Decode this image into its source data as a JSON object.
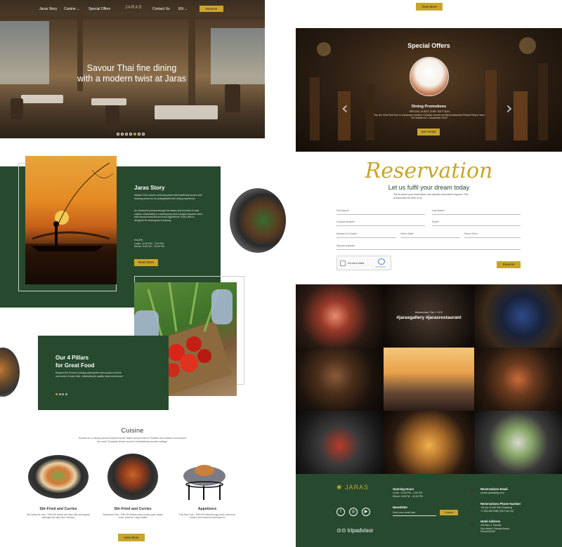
{
  "nav": {
    "items": [
      "Jaras Story",
      "Cuisine",
      "Special Offers",
      "Contact Us",
      "EN"
    ],
    "logo": "JARAS",
    "reserve": "Reserve"
  },
  "hero": {
    "title_line1": "Savour Thai fine dining",
    "title_line2": "with a modern twist at Jaras",
    "slide_count": 7,
    "active_slide": 4
  },
  "story": {
    "title": "Jaras Story",
    "para1": "Modern Thai cuisine, perfectly paired with traditional service and stunning views for an unforgettable fine dining experience.",
    "para2": "An immersive journey through the tastes and textures of local cuisine, showcasing a contemporary and lovingly prepared menu built around seasonal and local ingredients. Every dish is designed for sharing and exploring.",
    "hours_label": "HOURS",
    "lunch": "Lunch: 12:00 PM – 3:00 PM",
    "dinner": "Dinner: 6:00 PM – 10:00 PM",
    "read_more": "Read More"
  },
  "pillars": {
    "title_line1": "Our 4 Pillars",
    "title_line2": "for Great Food",
    "para": "Respect the Product | Always placing the main product at front and center of each dish, celebrating its quality, taste and texture."
  },
  "cuisine": {
    "title": "Cuisine",
    "subtitle": "Embark on a culinary journey inspired by the tastes and textures of Thailand and cuisines from around the world. Exquisite dishes served in breathtaking wooden settings.",
    "dishes": [
      {
        "name": "Stir-Fried and Curries",
        "desc": "Stir-frying the nam • THB 000 Desert sea bass with lemongrass galangal and spicy lime dressing"
      },
      {
        "name": "Stir-Fried and Curries",
        "desc": "Massaman Pae • THB 000 Braised slow-cooked goat, potato onion, peanuts, crispy shallot"
      },
      {
        "name": "Appetizers",
        "desc": "Pruk Nam Sue • THB 000 Steamed egg, fresh crab meat, chicken and seasonal mixed greens"
      }
    ],
    "view_more": "View More"
  },
  "top_view_more": "View More",
  "offers": {
    "title": "Special Offers",
    "promo_title": "Dining Promotions",
    "promo_line1": "SPECIAL GUEST CHEF 30TF SUN",
    "promo_line2": "Top UK Chef Seif Sun to showcase modern Chinese cuisine at InterContinental Phuket Resort from 29 October to 1 November 2019",
    "see_detail": "See Detail"
  },
  "reservation": {
    "script": "Reservation",
    "subtitle": "Let us fulfil your dream today",
    "note": "Tell us about your reservation and special reservation request. This is important for both of us.",
    "fields": {
      "first_name": "First Name*",
      "last_name": "Last Name*",
      "contact": "Contact Number*",
      "email": "Email*",
      "guests": "Number of Guests*",
      "date": "Select Date*",
      "time": "Select Time*",
      "special": "Special requests"
    },
    "captcha": "I'm not a robot",
    "captcha_brand": "reCAPTCHA",
    "reserve": "Reserve"
  },
  "gallery": {
    "caption_small": "Massaman Pae • XXX",
    "caption_tag": "#jarasgallery #jarasrestaurant"
  },
  "footer": {
    "logo": "JARAS",
    "opening_title": "Opening Hours",
    "lunch": "Lunch: 12:00 PM – 3:00 PM",
    "dinner": "Dinner: 6:00 PM – 10:00 PM",
    "newsletter_title": "Newsletter",
    "newsletter_placeholder": "Enter your email here",
    "submit": "Submit",
    "tripadvisor": "tripadvisor",
    "email_title": "Reservations Email",
    "email": "phuket.jaras@ihg.com",
    "phone_title": "Reservations Phone Number",
    "phone1": "+66 (0) 76 629 999 (Thailand)",
    "phone2": "+1 800 408 5385 (Toll Free US)",
    "address_title": "Hotel Address",
    "address1": "333 Moo 3, Kamala",
    "address2": "Sub-district, Kamala Beach,",
    "address3": "Phuket 83150"
  },
  "colors": {
    "green": "#27492e",
    "gold": "#c8a52a"
  }
}
